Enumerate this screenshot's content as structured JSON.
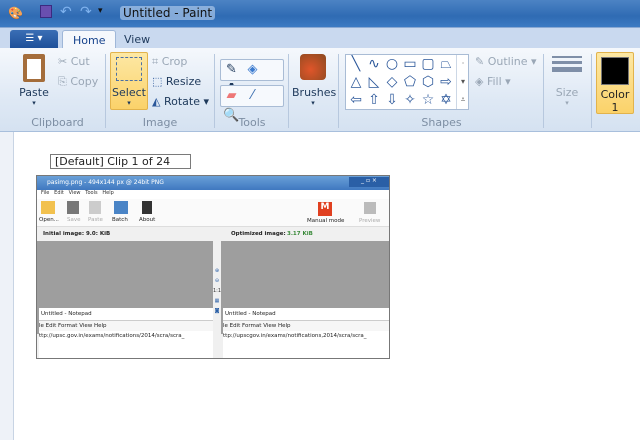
{
  "window": {
    "title": "Untitled - Paint"
  },
  "tabs": [
    {
      "label": "Home"
    },
    {
      "label": "View"
    }
  ],
  "clipboard": {
    "paste": "Paste",
    "cut": "Cut",
    "copy": "Copy",
    "label": "Clipboard"
  },
  "image": {
    "select": "Select",
    "crop": "Crop",
    "resize": "Resize",
    "rotate": "Rotate",
    "label": "Image"
  },
  "tools": {
    "label": "Tools"
  },
  "brushes": {
    "label": "Brushes"
  },
  "shapes": {
    "outline": "Outline",
    "fill": "Fill",
    "label": "Shapes"
  },
  "size": {
    "label": "Size"
  },
  "color1": {
    "label": "Color",
    "num": "1",
    "value": "#000000"
  },
  "canvas": {
    "clip_label": "[Default] Clip 1 of 24",
    "shot": {
      "title": "pasimg.png - 494x144 px @ 24bit PNG",
      "menu": [
        "File",
        "Edit",
        "View",
        "Tools",
        "Help"
      ],
      "toolbar": [
        "Open...",
        "Save",
        "Paste",
        "Batch",
        "About"
      ],
      "manual_mode": "Manual mode",
      "preview": "Preview",
      "initial": "Initial image:  9.0: KiB",
      "optimized": "Optimized image:",
      "optimized_size": "3.17 KiB",
      "zoom_ratio": "1:1",
      "np_title": "Untitled - Notepad",
      "np_menu": "le   Edit   Format   View   Help",
      "np_text_left": "ttp://upsc.gov.in/exams/notifications/2014/scra/scra_",
      "np_text_right": "ttp://upscgov.in/exams/notifications,2014/scra/scra_"
    }
  }
}
